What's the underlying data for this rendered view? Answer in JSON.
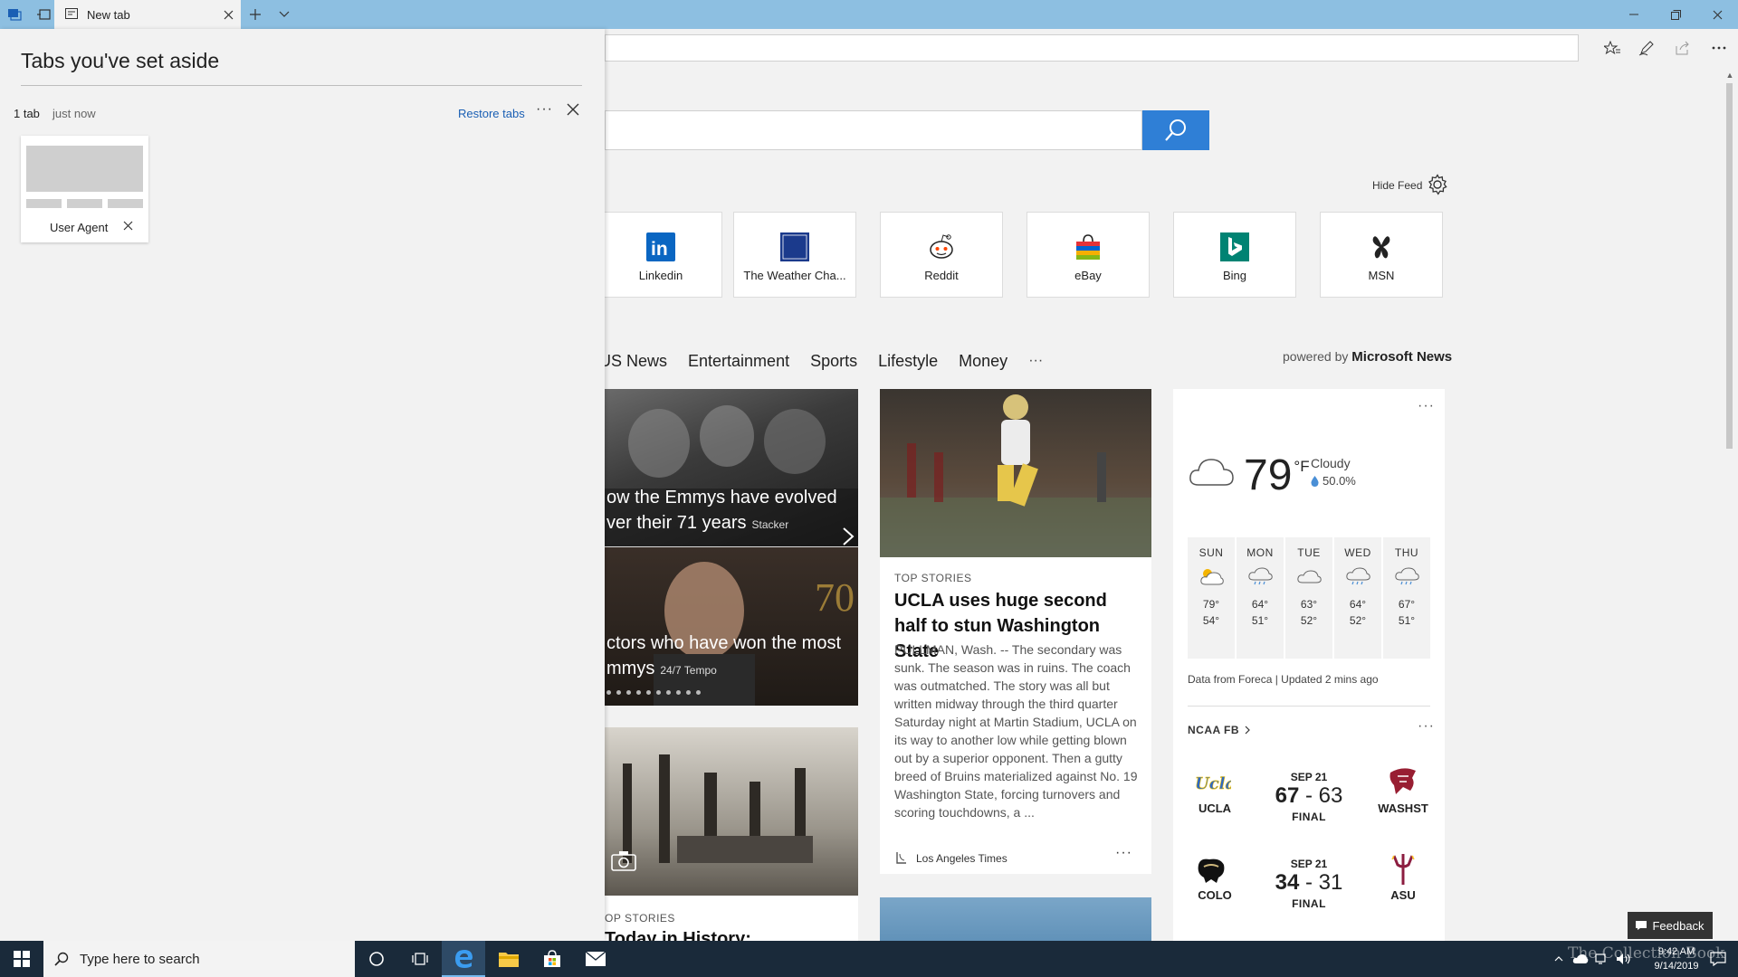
{
  "browser": {
    "tab_title": "New tab"
  },
  "aside": {
    "title": "Tabs you've set aside",
    "count": "1 tab",
    "time": "just now",
    "restore_label": "Restore tabs",
    "more_label": "···",
    "card_label": "User Agent"
  },
  "newtab": {
    "hide_feed_label": "Hide Feed",
    "tiles": [
      {
        "label": "Linkedin"
      },
      {
        "label": "The Weather Cha..."
      },
      {
        "label": "Reddit"
      },
      {
        "label": "eBay"
      },
      {
        "label": "Bing"
      },
      {
        "label": "MSN"
      }
    ],
    "news_nav": [
      "US News",
      "Entertainment",
      "Sports",
      "Lifestyle",
      "Money",
      "···"
    ],
    "powered_by": "powered by",
    "powered_brand": "Microsoft News"
  },
  "stories": {
    "slideshow": {
      "line1_a": "ow the Emmys have evolved",
      "line1_b": "ver their 71 years",
      "source1": "Stacker",
      "line2_a": "ctors who have won the most",
      "line2_b": "mmys",
      "source2": "24/7 Tempo"
    },
    "ucla": {
      "kicker": "TOP STORIES",
      "headline": "UCLA uses huge second half to stun Washington State",
      "summary": "PULLMAN, Wash. -- The secondary was sunk. The season was in ruins. The coach was outmatched. The story was all but written midway through the third quarter Saturday night at Martin Stadium, UCLA on its way to another low while getting blown out by a superior opponent. Then a gutty breed of Bruins materialized against No. 19 Washington State, forcing turnovers and scoring touchdowns, a ...",
      "source": "Los Angeles Times",
      "more": "···"
    },
    "history": {
      "kicker": "OP STORIES",
      "headline": "Today in History:"
    }
  },
  "weather": {
    "more": "···",
    "temp": "79",
    "unit": "°F",
    "condition": "Cloudy",
    "precip": "50.0%",
    "forecast": [
      {
        "day": "SUN",
        "high": "79°",
        "low": "54°",
        "icon": "sun-cloud-icon"
      },
      {
        "day": "MON",
        "high": "64°",
        "low": "51°",
        "icon": "rain-cloud-icon"
      },
      {
        "day": "TUE",
        "high": "63°",
        "low": "52°",
        "icon": "cloud-icon"
      },
      {
        "day": "WED",
        "high": "64°",
        "low": "52°",
        "icon": "rain-cloud-icon"
      },
      {
        "day": "THU",
        "high": "67°",
        "low": "51°",
        "icon": "rain-cloud-icon"
      }
    ],
    "attribution": "Data from Foreca | Updated 2 mins ago"
  },
  "scores": {
    "league": "NCAA FB",
    "more": "···",
    "games": [
      {
        "date": "SEP 21",
        "home": "UCLA",
        "away": "WASHST",
        "home_score": "67",
        "away_score": "63",
        "status": "FINAL"
      },
      {
        "date": "SEP 21",
        "home": "COLO",
        "away": "ASU",
        "home_score": "34",
        "away_score": "31",
        "status": "FINAL"
      }
    ]
  },
  "feedback_label": "Feedback",
  "taskbar": {
    "search_placeholder": "Type here to search",
    "time": "9:42 AM",
    "date": "9/14/2019",
    "watermark": "The Collection Book"
  },
  "colors": {
    "titlebar": "#8dbfe1",
    "accent": "#2f7fd6",
    "link": "#1a5fb4",
    "taskbar": "#1a2a3a"
  }
}
